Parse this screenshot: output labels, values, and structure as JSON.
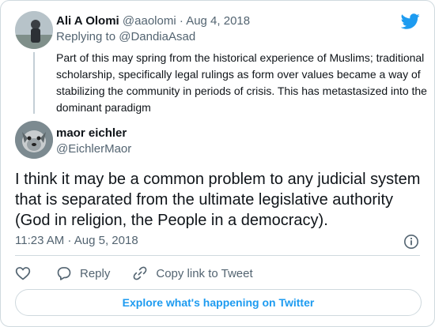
{
  "brand_color": "#1d9bf0",
  "icons": {
    "logo": "twitter-bird-icon",
    "like": "heart-icon",
    "reply": "reply-bubble-icon",
    "copy": "link-icon",
    "info": "info-icon"
  },
  "parent_tweet": {
    "name": "Ali A Olomi",
    "handle": "@aaolomi",
    "separator": "·",
    "date": "Aug 4, 2018",
    "replying_prefix": "Replying to",
    "replying_to": "@DandiaAsad",
    "text": "Part of this may spring from the historical experience of Muslims; traditional scholarship, specifically legal rulings as form over values became a way of stabilizing the community in periods of crisis. This has metastasized into the dominant paradigm"
  },
  "tweet": {
    "name": "maor eichler",
    "handle": "@EichlerMaor",
    "text": "I think it may be a common problem to any judicial system that is separated from the ultimate legislative authority (God in religion, the People in a democracy).",
    "timestamp": "11:23 AM · Aug 5, 2018"
  },
  "actions": {
    "reply_label": "Reply",
    "copy_label": "Copy link to Tweet"
  },
  "explore_label": "Explore what's happening on Twitter"
}
